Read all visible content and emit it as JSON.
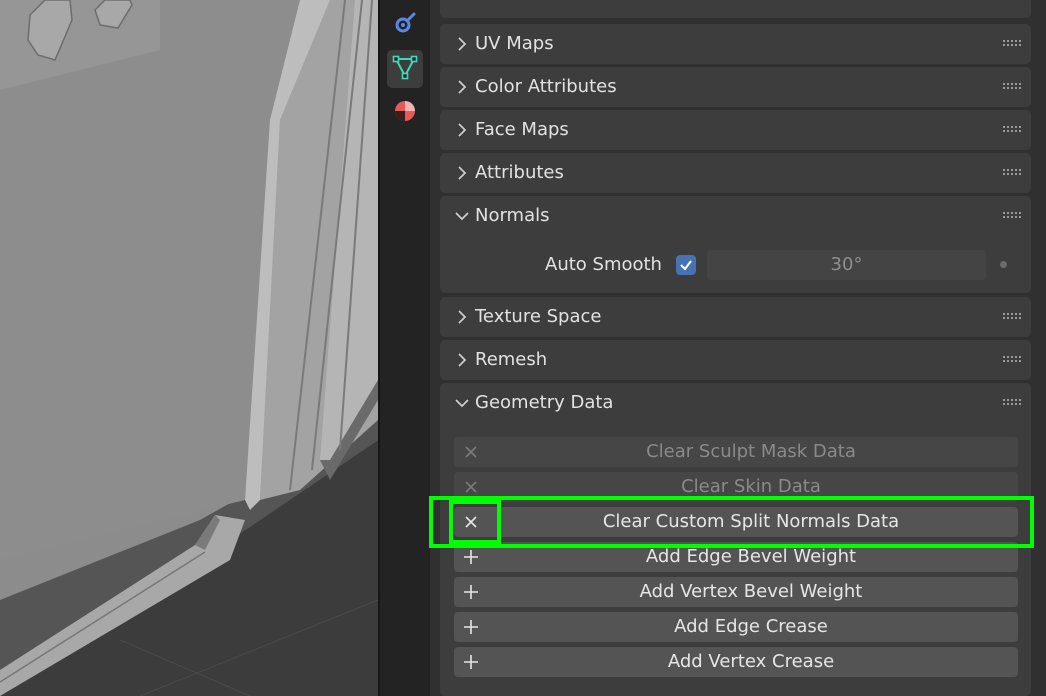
{
  "icons": {
    "tab_constraints": "object-constraint-icon",
    "tab_data": "mesh-data-icon",
    "tab_material": "material-icon",
    "collapsed": "chevron-right-icon",
    "expanded": "chevron-down-icon",
    "grip": "drag-grip-icon",
    "clear": "x-icon",
    "add": "plus-icon",
    "checkbox": "checkmark-icon"
  },
  "colors": {
    "accent_checkbox": "#4772b3",
    "highlight": "#00ff00",
    "mesh_icon": "#3fd9b7",
    "material_icon": "#e35a5a",
    "constraint_icon": "#5a86e6"
  },
  "panels": {
    "uv_maps": "UV Maps",
    "color_attributes": "Color Attributes",
    "face_maps": "Face Maps",
    "attributes": "Attributes",
    "normals": "Normals",
    "texture_space": "Texture Space",
    "remesh": "Remesh",
    "geometry_data": "Geometry Data"
  },
  "normals": {
    "auto_smooth_label": "Auto Smooth",
    "auto_smooth_checked": true,
    "angle_value": "30°"
  },
  "geometry_data": {
    "buttons": [
      {
        "label": "Clear Sculpt Mask Data",
        "icon": "x-icon",
        "enabled": false
      },
      {
        "label": "Clear Skin Data",
        "icon": "x-icon",
        "enabled": false
      },
      {
        "label": "Clear Custom Split Normals Data",
        "icon": "x-icon",
        "enabled": true,
        "highlighted": true
      },
      {
        "label": "Add Edge Bevel Weight",
        "icon": "plus-icon",
        "enabled": true
      },
      {
        "label": "Add Vertex Bevel Weight",
        "icon": "plus-icon",
        "enabled": true
      },
      {
        "label": "Add Edge Crease",
        "icon": "plus-icon",
        "enabled": true
      },
      {
        "label": "Add Vertex Crease",
        "icon": "plus-icon",
        "enabled": true
      }
    ]
  }
}
